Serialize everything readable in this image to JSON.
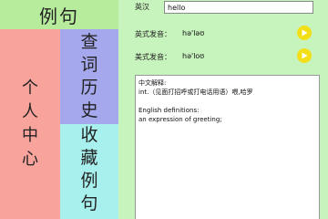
{
  "sidebar": {
    "example_tab": "例句",
    "personal_center": [
      "个",
      "人",
      "中",
      "心"
    ],
    "query_history": [
      "查",
      "词",
      "历",
      "史"
    ],
    "favorite_examples": [
      "收",
      "藏",
      "例",
      "句"
    ]
  },
  "search": {
    "language_label": "英汉",
    "value": "hello"
  },
  "pronunciation": {
    "uk_label": "英式发音：",
    "uk_phonetic": "hə'ləʊ",
    "us_label": "美式发音：",
    "us_phonetic": "hə'loʊ"
  },
  "definition": {
    "cn_heading": "中文解释:",
    "cn_text": "int.（见面打招呼或打电话用语）喂,哈罗",
    "en_heading": "English definitions:",
    "en_text": "an expression of greeting;"
  },
  "colors": {
    "green_tab": "#b6ec9c",
    "personal_bg": "#f8a39c",
    "query_bg": "#a6a8ee",
    "favorite_bg": "#a8f0ee",
    "content_bg": "#c7f3bc",
    "play_button": "#f3df18"
  },
  "icons": {
    "play": "play-icon"
  }
}
